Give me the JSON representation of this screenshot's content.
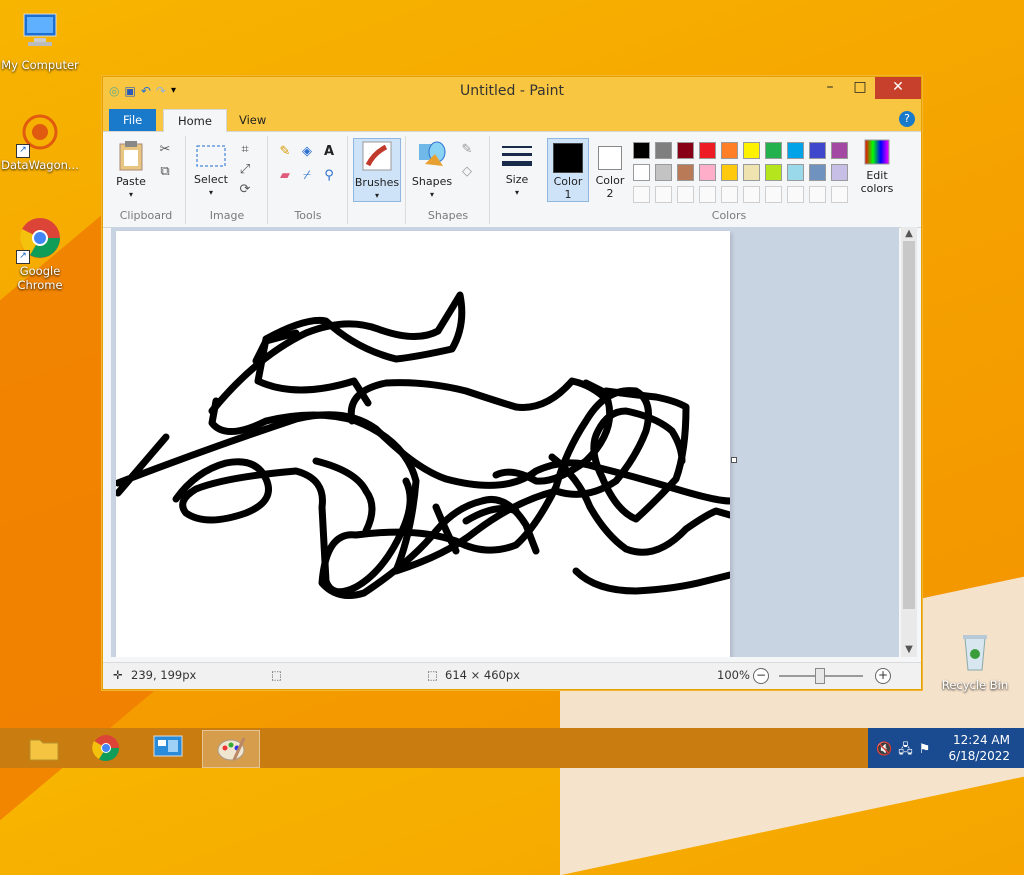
{
  "desktop": {
    "icons": [
      {
        "label": "My Computer"
      },
      {
        "label": "DataWagon..."
      },
      {
        "label": "Google Chrome"
      },
      {
        "label": "Recycle Bin"
      }
    ]
  },
  "window": {
    "title": "Untitled - Paint",
    "tabs": {
      "file": "File",
      "home": "Home",
      "view": "View"
    },
    "ribbon": {
      "clipboard": {
        "label": "Clipboard",
        "paste": "Paste"
      },
      "image": {
        "label": "Image",
        "select": "Select"
      },
      "tools": {
        "label": "Tools"
      },
      "brushes": {
        "label": "Brushes"
      },
      "shapes": {
        "label": "Shapes",
        "button": "Shapes"
      },
      "size": {
        "label": "Size"
      },
      "colors": {
        "label": "Colors",
        "color1": "Color 1",
        "color2": "Color 2",
        "edit": "Edit colors",
        "color1_value": "#000000",
        "color2_value": "#ffffff",
        "palette_row1": [
          "#000000",
          "#7f7f7f",
          "#880015",
          "#ed1c24",
          "#ff7f27",
          "#fff200",
          "#22b14c",
          "#00a2e8",
          "#3f48cc",
          "#a349a4"
        ],
        "palette_row2": [
          "#ffffff",
          "#c3c3c3",
          "#b97a57",
          "#ffaec9",
          "#ffc90e",
          "#efe4b0",
          "#b5e61d",
          "#99d9ea",
          "#7092be",
          "#c8bfe7"
        ]
      }
    },
    "status": {
      "cursor": "239, 199px",
      "size": "614 × 460px",
      "zoom": "100%"
    }
  },
  "taskbar": {
    "time": "12:24 AM",
    "date": "6/18/2022"
  }
}
